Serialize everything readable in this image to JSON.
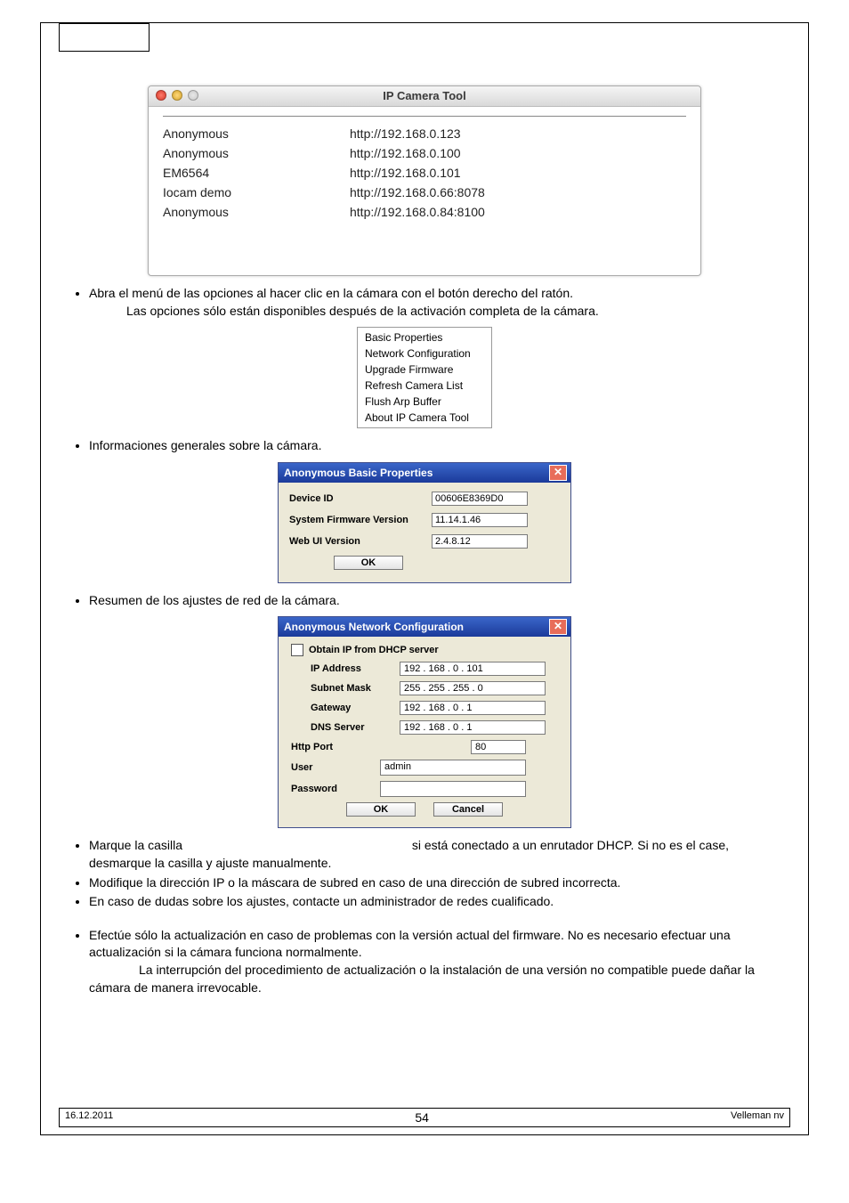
{
  "ip_tool": {
    "title": "IP Camera Tool",
    "rows": [
      {
        "name": "Anonymous",
        "url": "http://192.168.0.123"
      },
      {
        "name": "Anonymous",
        "url": "http://192.168.0.100"
      },
      {
        "name": "EM6564",
        "url": "http://192.168.0.101"
      },
      {
        "name": "Iocam demo",
        "url": "http://192.168.0.66:8078"
      },
      {
        "name": "Anonymous",
        "url": "http://192.168.0.84:8100"
      }
    ]
  },
  "bullet1a": "Abra el menú de las opciones al hacer clic en la cámara con el botón derecho del ratón.",
  "bullet1b": "Las opciones sólo están disponibles después de la activación completa de la cámara.",
  "context_menu": [
    "Basic Properties",
    "Network Configuration",
    "Upgrade Firmware",
    "Refresh Camera List",
    "Flush Arp Buffer",
    "About IP Camera Tool"
  ],
  "bullet2": "Informaciones generales sobre la cámara.",
  "props_dialog": {
    "title": "Anonymous Basic Properties",
    "rows": [
      {
        "label": "Device ID",
        "value": "00606E8369D0"
      },
      {
        "label": "System Firmware Version",
        "value": "11.14.1.46"
      },
      {
        "label": "Web UI Version",
        "value": "2.4.8.12"
      }
    ],
    "ok": "OK"
  },
  "bullet3": "Resumen de los ajustes de red de la cámara.",
  "net_dialog": {
    "title": "Anonymous Network Configuration",
    "dhcp": "Obtain IP from DHCP server",
    "ip_label": "IP Address",
    "ip": "192 . 168 .  0  . 101",
    "mask_label": "Subnet Mask",
    "mask": "255 . 255 . 255 .  0",
    "gw_label": "Gateway",
    "gw": "192 . 168 .  0  .  1",
    "dns_label": "DNS Server",
    "dns": "192 . 168 .  0  .  1",
    "port_label": "Http Port",
    "port": "80",
    "user_label": "User",
    "user": "admin",
    "pw_label": "Password",
    "pw": "",
    "ok": "OK",
    "cancel": "Cancel"
  },
  "bullet4a": "Marque la casilla",
  "bullet4b": "si está conectado a un enrutador DHCP. Si no es el case, desmarque la casilla y ajuste manualmente.",
  "bullet5": "Modifique la dirección IP o la máscara de subred en caso de una dirección de subred incorrecta.",
  "bullet6": "En caso de dudas sobre los ajustes, contacte un administrador de redes cualificado.",
  "bullet7a": "Efectúe sólo la actualización en caso de problemas con la versión actual del firmware. No es necesario efectuar una actualización si la cámara funciona normalmente.",
  "bullet7b": "La interrupción del procedimiento de actualización o la instalación de una versión no compatible puede dañar la cámara de manera irrevocable.",
  "footer": {
    "date": "16.12.2011",
    "page": "54",
    "brand": "Velleman nv"
  }
}
